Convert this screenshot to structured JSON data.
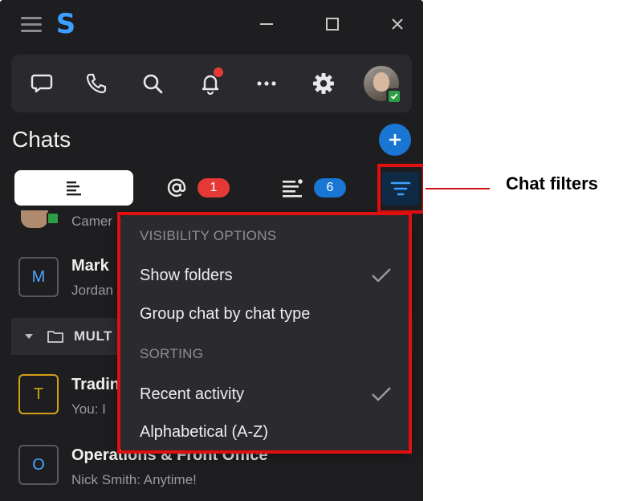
{
  "window": {
    "logo_letter": "S"
  },
  "toolbar": {
    "icons": [
      "chat-icon",
      "phone-icon",
      "search-icon",
      "bell-icon",
      "more-icon",
      "gear-icon"
    ]
  },
  "chats": {
    "title": "Chats",
    "tabs": [
      {
        "name": "all",
        "icon": "list-icon"
      },
      {
        "name": "mentions",
        "icon": "at-icon",
        "badge": "1"
      },
      {
        "name": "unread",
        "icon": "list-dot-icon",
        "badge": "6"
      }
    ],
    "list": [
      {
        "avatar": "",
        "name": "",
        "preview": "Camer"
      },
      {
        "avatar": "M",
        "name": "Mark",
        "preview": "Jordan"
      },
      {
        "avatar": "T",
        "name": "Tradin",
        "preview": "You: I"
      },
      {
        "avatar": "O",
        "name": "Operations & Front Office",
        "preview": "Nick Smith: Anytime!"
      }
    ],
    "folder": {
      "label": "MULT"
    }
  },
  "dropdown": {
    "visibility_header": "VISIBILITY OPTIONS",
    "show_folders": "Show folders",
    "group_chat": "Group chat by chat type",
    "sorting_header": "SORTING",
    "recent_activity": "Recent activity",
    "alphabetical": "Alphabetical (A-Z)"
  },
  "callout": {
    "label": "Chat filters"
  },
  "colors": {
    "accent": "#1976d2",
    "highlight": "#e01010",
    "mention_badge": "#e53935",
    "online": "#2e9e44"
  }
}
